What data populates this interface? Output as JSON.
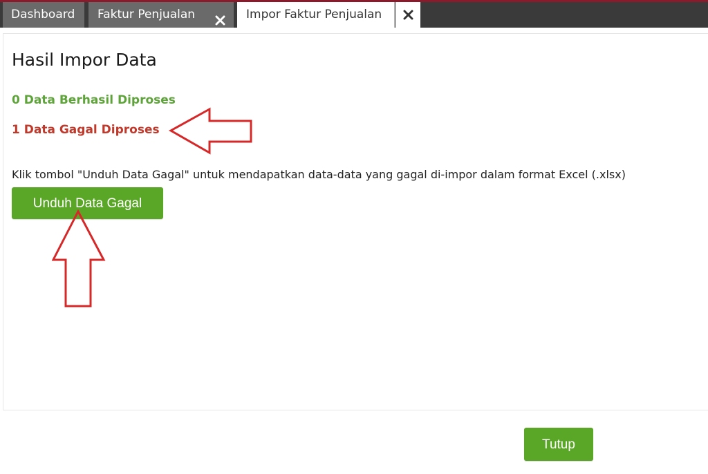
{
  "tabs": [
    {
      "label": "Dashboard",
      "active": false,
      "closable": false
    },
    {
      "label": "Faktur Penjualan",
      "active": false,
      "closable": true
    },
    {
      "label": "Impor Faktur Penjualan",
      "active": true,
      "closable": true
    }
  ],
  "icons": {
    "tab_close": "close-icon (x)",
    "annotation_left": "arrow-left-icon",
    "annotation_up": "arrow-up-icon"
  },
  "main": {
    "title": "Hasil Impor Data",
    "success_status": "0 Data Berhasil Diproses",
    "failed_status": "1 Data Gagal Diproses",
    "instructions": "Klik tombol \"Unduh Data Gagal\" untuk mendapatkan data-data yang gagal di-impor dalam format Excel (.xlsx)",
    "download_button_label": "Unduh Data Gagal"
  },
  "footer": {
    "close_button_label": "Tutup"
  },
  "colors": {
    "accent_green": "#5aa627",
    "success_text": "#5ea43a",
    "failed_text": "#c0392b",
    "tab_bar": "#3a3a3a",
    "tab_inactive": "#6a6a6a",
    "top_line": "#8b1a2c",
    "annotation_arrow": "#d62828"
  }
}
